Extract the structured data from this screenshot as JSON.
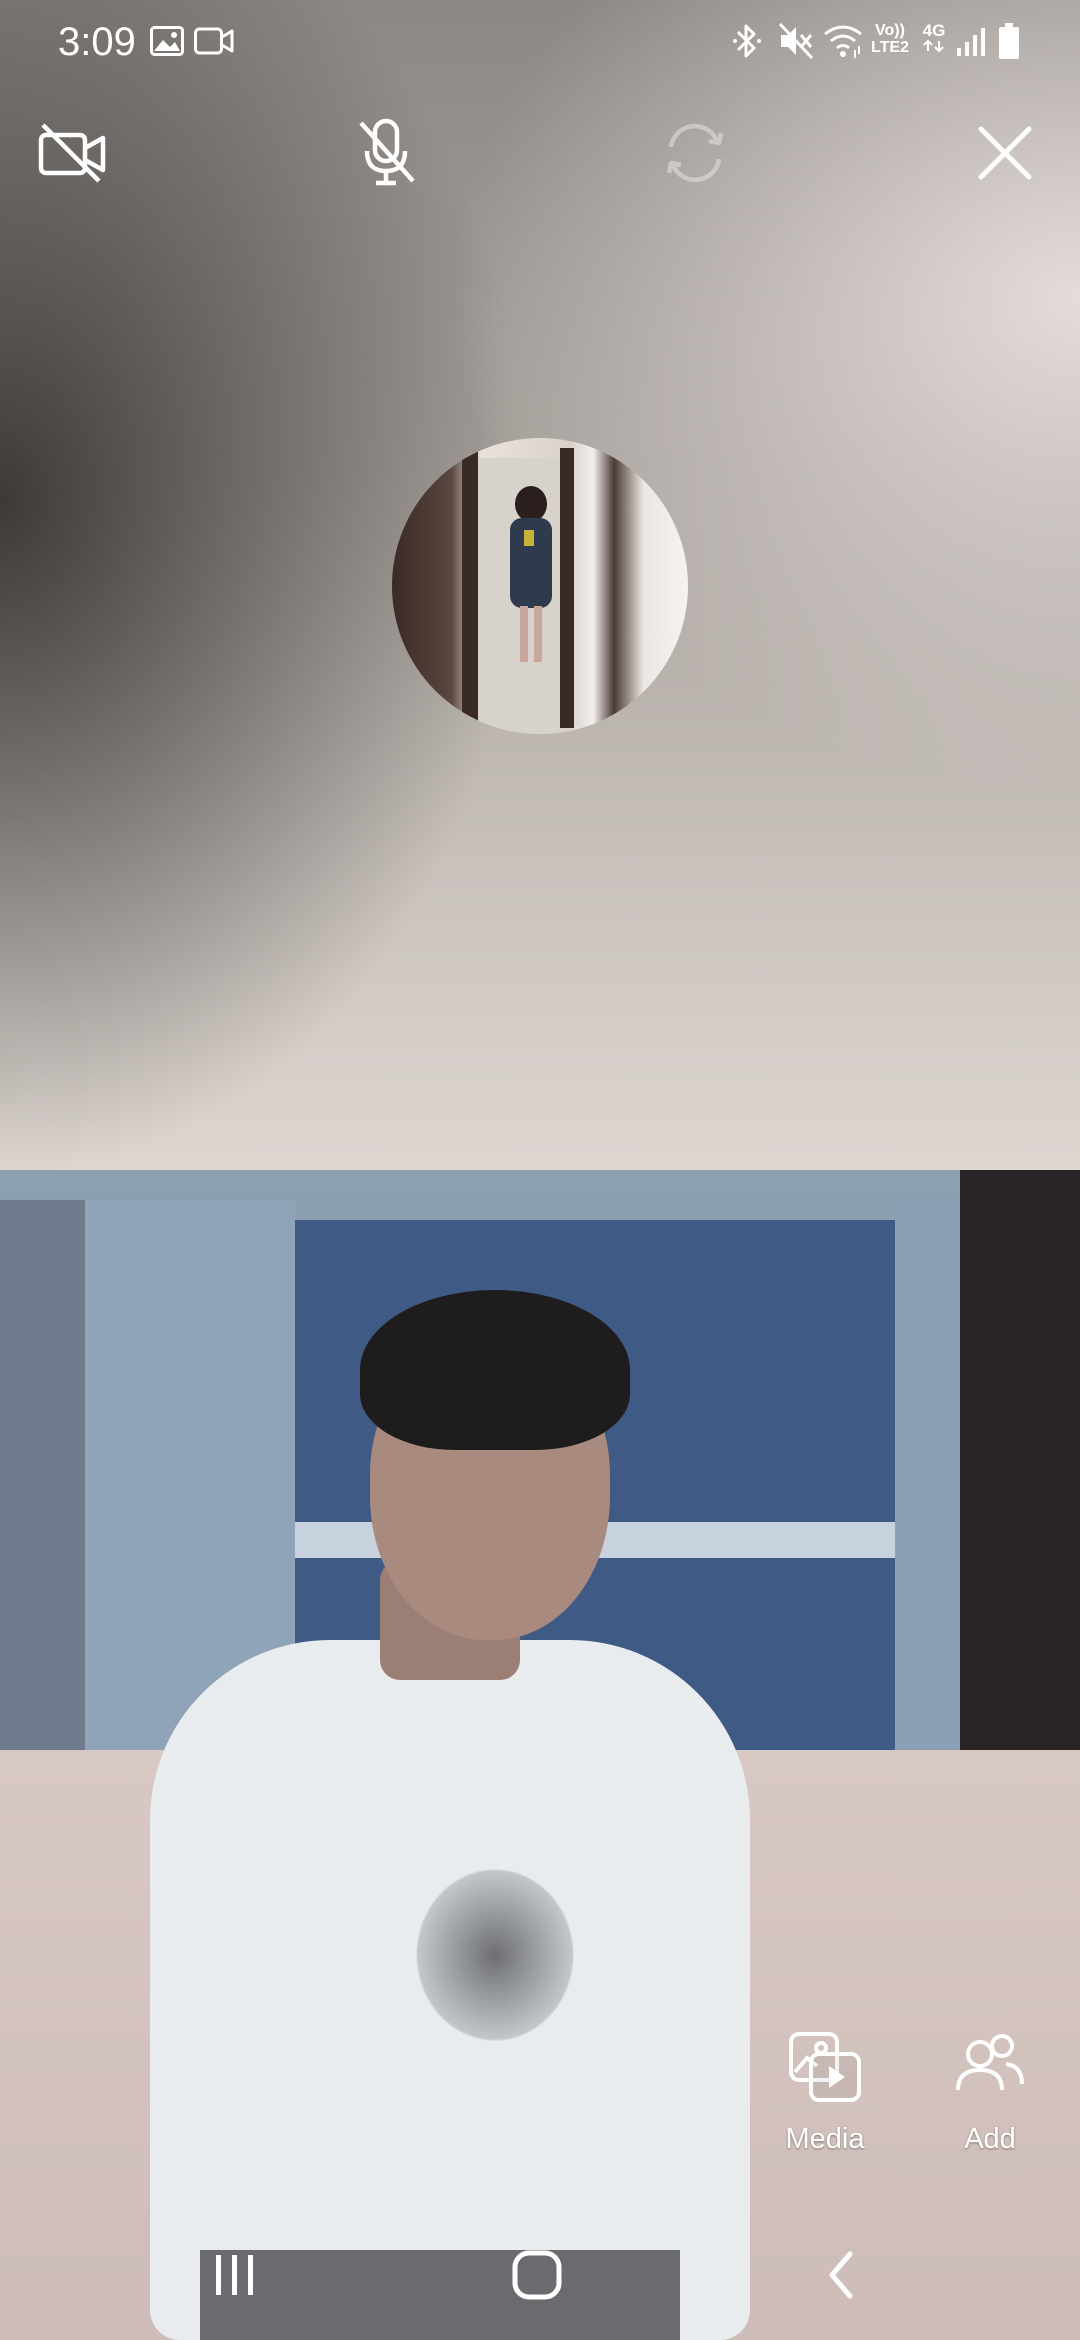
{
  "status_bar": {
    "time": "3:09",
    "icons": [
      "image-icon",
      "video-icon",
      "bluetooth-icon",
      "mute-icon",
      "wifi-icon",
      "volte-icon",
      "4g-icon",
      "signal-icon",
      "battery-icon"
    ],
    "volte_label_top": "Vo))",
    "volte_label_bottom": "LTE2",
    "network_label": "4G"
  },
  "call_controls": {
    "items": [
      {
        "name": "video-off",
        "icon": "video-off-icon"
      },
      {
        "name": "mute-mic",
        "icon": "mic-off-icon"
      },
      {
        "name": "switch-camera",
        "icon": "camera-switch-icon",
        "disabled": true
      },
      {
        "name": "end-call",
        "icon": "close-icon"
      }
    ]
  },
  "actions": {
    "media_label": "Media",
    "add_label": "Add"
  },
  "nav_bar": {
    "items": [
      "recent-apps-icon",
      "home-icon",
      "back-icon"
    ]
  },
  "colors": {
    "icon": "#ffffff",
    "disabled_icon": "#c9c6c4"
  }
}
